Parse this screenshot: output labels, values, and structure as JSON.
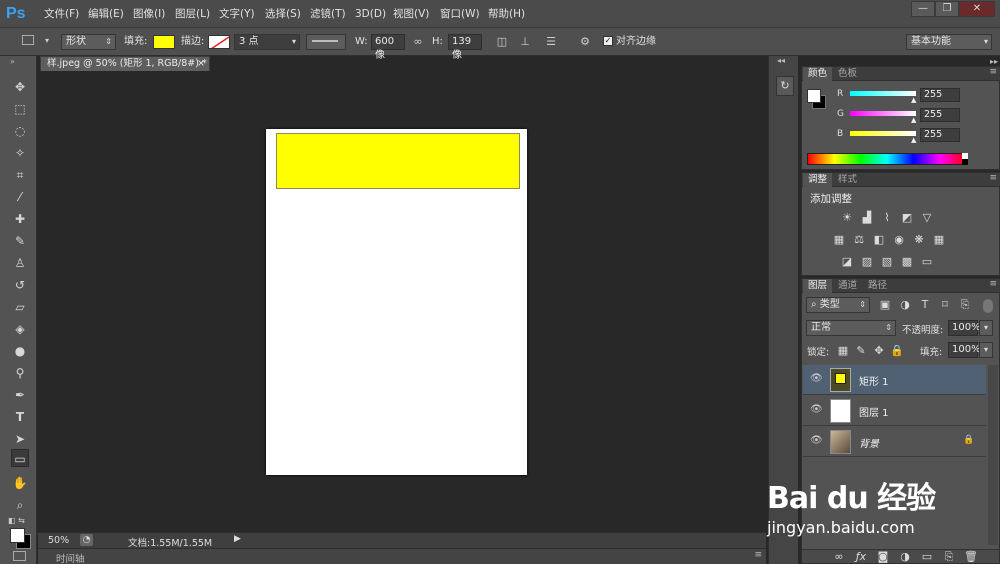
{
  "app": {
    "logo": "Ps"
  },
  "menu": [
    "文件(F)",
    "编辑(E)",
    "图像(I)",
    "图层(L)",
    "文字(Y)",
    "选择(S)",
    "滤镜(T)",
    "3D(D)",
    "视图(V)",
    "窗口(W)",
    "帮助(H)"
  ],
  "window_controls": {
    "minimize": "—",
    "restore": "❐",
    "close": "✕"
  },
  "options": {
    "mode": "形状",
    "fill_label": "填充:",
    "fill_color": "#ffff00",
    "stroke_label": "描边:",
    "stroke_size": "3 点",
    "w_label": "W:",
    "w_value": "600 像",
    "h_label": "H:",
    "h_value": "139 像",
    "align_edges_label": "对齐边缘",
    "workspace": "基本功能"
  },
  "document": {
    "tab_title": "样.jpeg @ 50% (矩形 1, RGB/8#) *",
    "tab_close": "×",
    "zoom": "50%",
    "doc_info": "文档:1.55M/1.55M",
    "timeline_label": "时间轴",
    "canvas_color": "#ffffff",
    "rect_color": "#ffff00"
  },
  "color_panel": {
    "tabs": [
      "颜色",
      "色板"
    ],
    "r_label": "R",
    "r_value": "255",
    "g_label": "G",
    "g_value": "255",
    "b_label": "B",
    "b_value": "255"
  },
  "adjust_panel": {
    "tabs": [
      "调整",
      "样式"
    ],
    "title": "添加调整"
  },
  "layers_panel": {
    "tabs": [
      "图层",
      "通道",
      "路径"
    ],
    "filter_kind": "类型",
    "blend_mode": "正常",
    "opacity_label": "不透明度:",
    "opacity_value": "100%",
    "lock_label": "锁定:",
    "fill_label": "填充:",
    "fill_value": "100%",
    "layers": [
      {
        "name": "矩形 1",
        "selected": true
      },
      {
        "name": "图层 1",
        "selected": false
      },
      {
        "name": "背景",
        "selected": false
      }
    ]
  },
  "watermark": {
    "logo": "Bai du 经验",
    "url": "jingyan.baidu.com"
  }
}
